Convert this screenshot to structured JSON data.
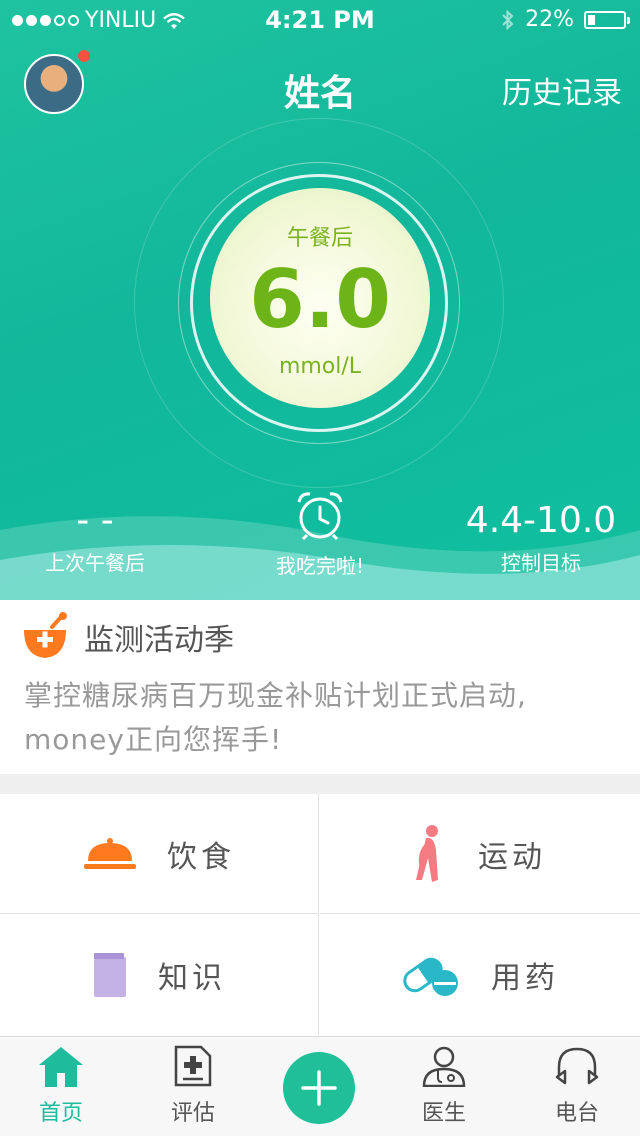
{
  "status_bar": {
    "carrier": "YINLIU",
    "time": "4:21 PM",
    "battery": "22%",
    "battery_level": 0.22
  },
  "header": {
    "title": "姓名",
    "history_link": "历史记录"
  },
  "reading": {
    "label": "午餐后",
    "value": "6.0",
    "unit": "mmol/L"
  },
  "stats": {
    "last": {
      "value": "- -",
      "label": "上次午餐后"
    },
    "eat": {
      "label": "我吃完啦!"
    },
    "target": {
      "value": "4.4-10.0",
      "label": "控制目标"
    }
  },
  "notice": {
    "title": "监测活动季",
    "body": "掌控糖尿病百万现金补贴计划正式启动, money正向您挥手!"
  },
  "grid": {
    "diet": "饮食",
    "sport": "运动",
    "knowledge": "知识",
    "medicine": "用药"
  },
  "tabs": {
    "home": "首页",
    "assess": "评估",
    "doctor": "医生",
    "radio": "电台"
  },
  "colors": {
    "accent": "#1ebc9c",
    "orange": "#ff7a1f",
    "value_green": "#6db419"
  }
}
